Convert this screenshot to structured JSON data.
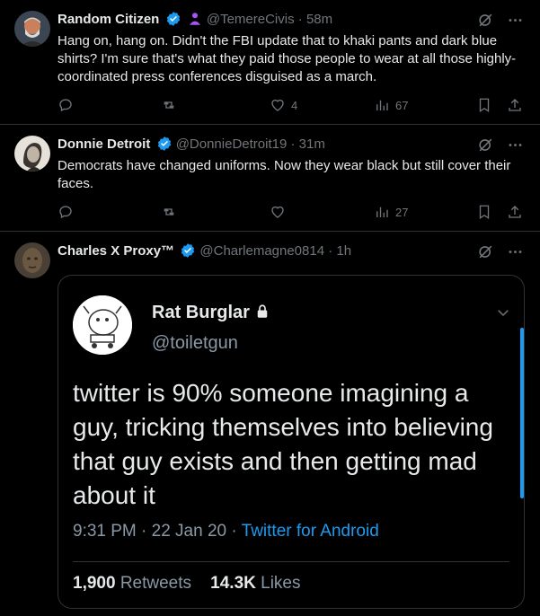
{
  "tweets": [
    {
      "name": "Random Citizen",
      "handle": "@TemereCivis",
      "time": "58m",
      "text": "Hang on, hang on. Didn't the FBI update that to khaki pants and dark blue shirts? I'm sure that's what they paid those people to wear at all those highly-coordinated press conferences disguised as a march.",
      "likes": "4",
      "views": "67"
    },
    {
      "name": "Donnie Detroit",
      "handle": "@DonnieDetroit19",
      "time": "31m",
      "text": "Democrats have changed uniforms. Now they wear black but still cover their faces.",
      "likes": "",
      "views": "27"
    },
    {
      "name": "Charles X Proxy™",
      "handle": "@Charlemagne0814",
      "time": "1h"
    }
  ],
  "quoted": {
    "name": "Rat Burglar",
    "handle": "@toiletgun",
    "text": "twitter is 90% someone imagining a guy, tricking themselves into believing that guy exists and then getting mad about it",
    "time": "9:31 PM · 22 Jan 20 · ",
    "source": "Twitter for Android",
    "retweets_count": "1,900",
    "retweets_label": "Retweets",
    "likes_count": "14.3K",
    "likes_label": "Likes"
  },
  "dot": " · ",
  "colors": {
    "accent": "#1d9bf0",
    "muted": "#71767b",
    "background": "#000000"
  }
}
